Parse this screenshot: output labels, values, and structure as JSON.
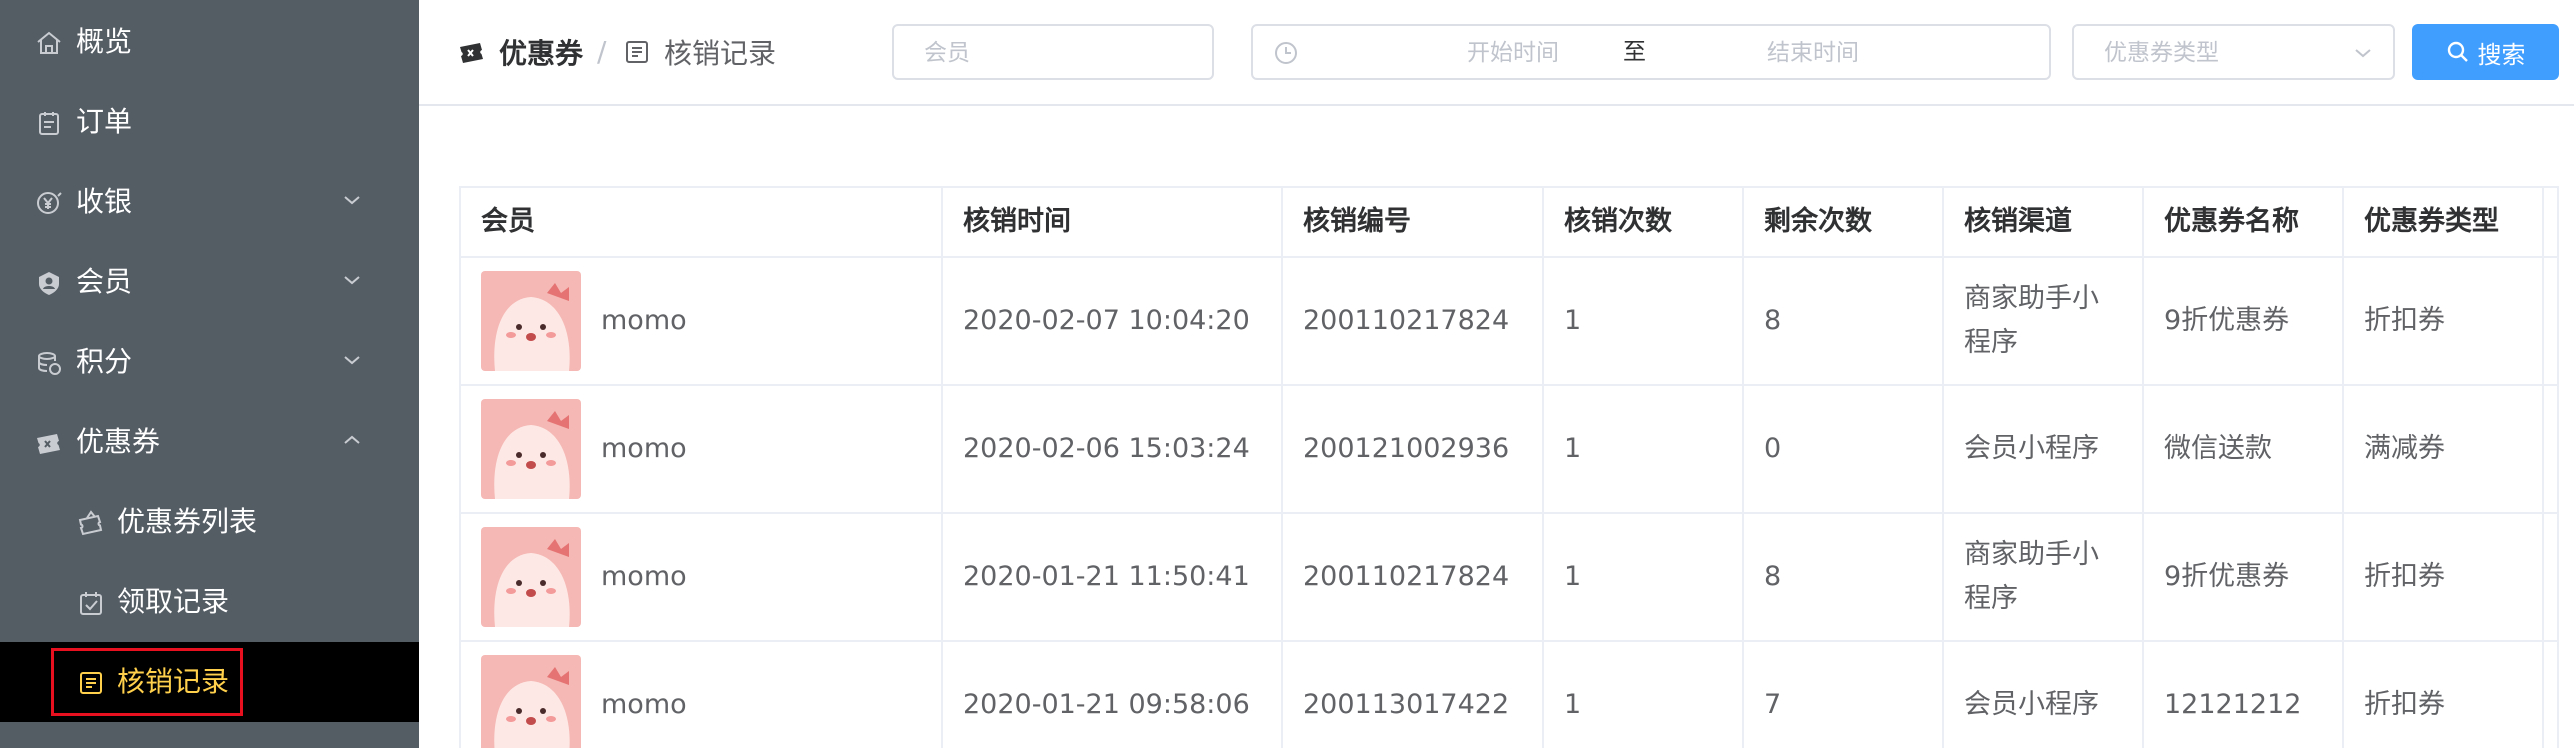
{
  "sidebar": {
    "items": [
      {
        "label": "概览",
        "icon": "home-icon"
      },
      {
        "label": "订单",
        "icon": "order-icon"
      },
      {
        "label": "收银",
        "icon": "cashier-icon"
      },
      {
        "label": "会员",
        "icon": "member-icon"
      },
      {
        "label": "积分",
        "icon": "points-icon"
      },
      {
        "label": "优惠券",
        "icon": "coupon-icon"
      },
      {
        "label": "优惠券列表",
        "icon": "coupon-list-icon"
      },
      {
        "label": "领取记录",
        "icon": "receive-record-icon"
      },
      {
        "label": "核销记录",
        "icon": "verify-record-icon"
      }
    ],
    "bg_color": "#545c64",
    "active_color": "#ffd04b"
  },
  "breadcrumb": {
    "root": "优惠券",
    "current": "核销记录",
    "separator": "/"
  },
  "filters": {
    "member_placeholder": "会员",
    "start_placeholder": "开始时间",
    "range_separator": "至",
    "end_placeholder": "结束时间",
    "type_placeholder": "优惠券类型",
    "search_label": "搜索"
  },
  "table": {
    "columns": [
      "会员",
      "核销时间",
      "核销编号",
      "核销次数",
      "剩余次数",
      "核销渠道",
      "优惠券名称",
      "优惠券类型"
    ],
    "rows": [
      [
        "momo",
        "2020-02-07 10:04:20",
        "200110217824",
        "1",
        "8",
        "商家助手小程序",
        "9折优惠券",
        "折扣券"
      ],
      [
        "momo",
        "2020-02-06 15:03:24",
        "200121002936",
        "1",
        "0",
        "会员小程序",
        "微信送款",
        "满减券"
      ],
      [
        "momo",
        "2020-01-21 11:50:41",
        "200110217824",
        "1",
        "8",
        "商家助手小程序",
        "9折优惠券",
        "折扣券"
      ],
      [
        "momo",
        "2020-01-21 09:58:06",
        "200113017422",
        "1",
        "7",
        "会员小程序",
        "12121212",
        "折扣券"
      ]
    ]
  },
  "colors": {
    "primary": "#409eff",
    "border": "#ebeef5",
    "highlight_frame": "#e8101e"
  }
}
